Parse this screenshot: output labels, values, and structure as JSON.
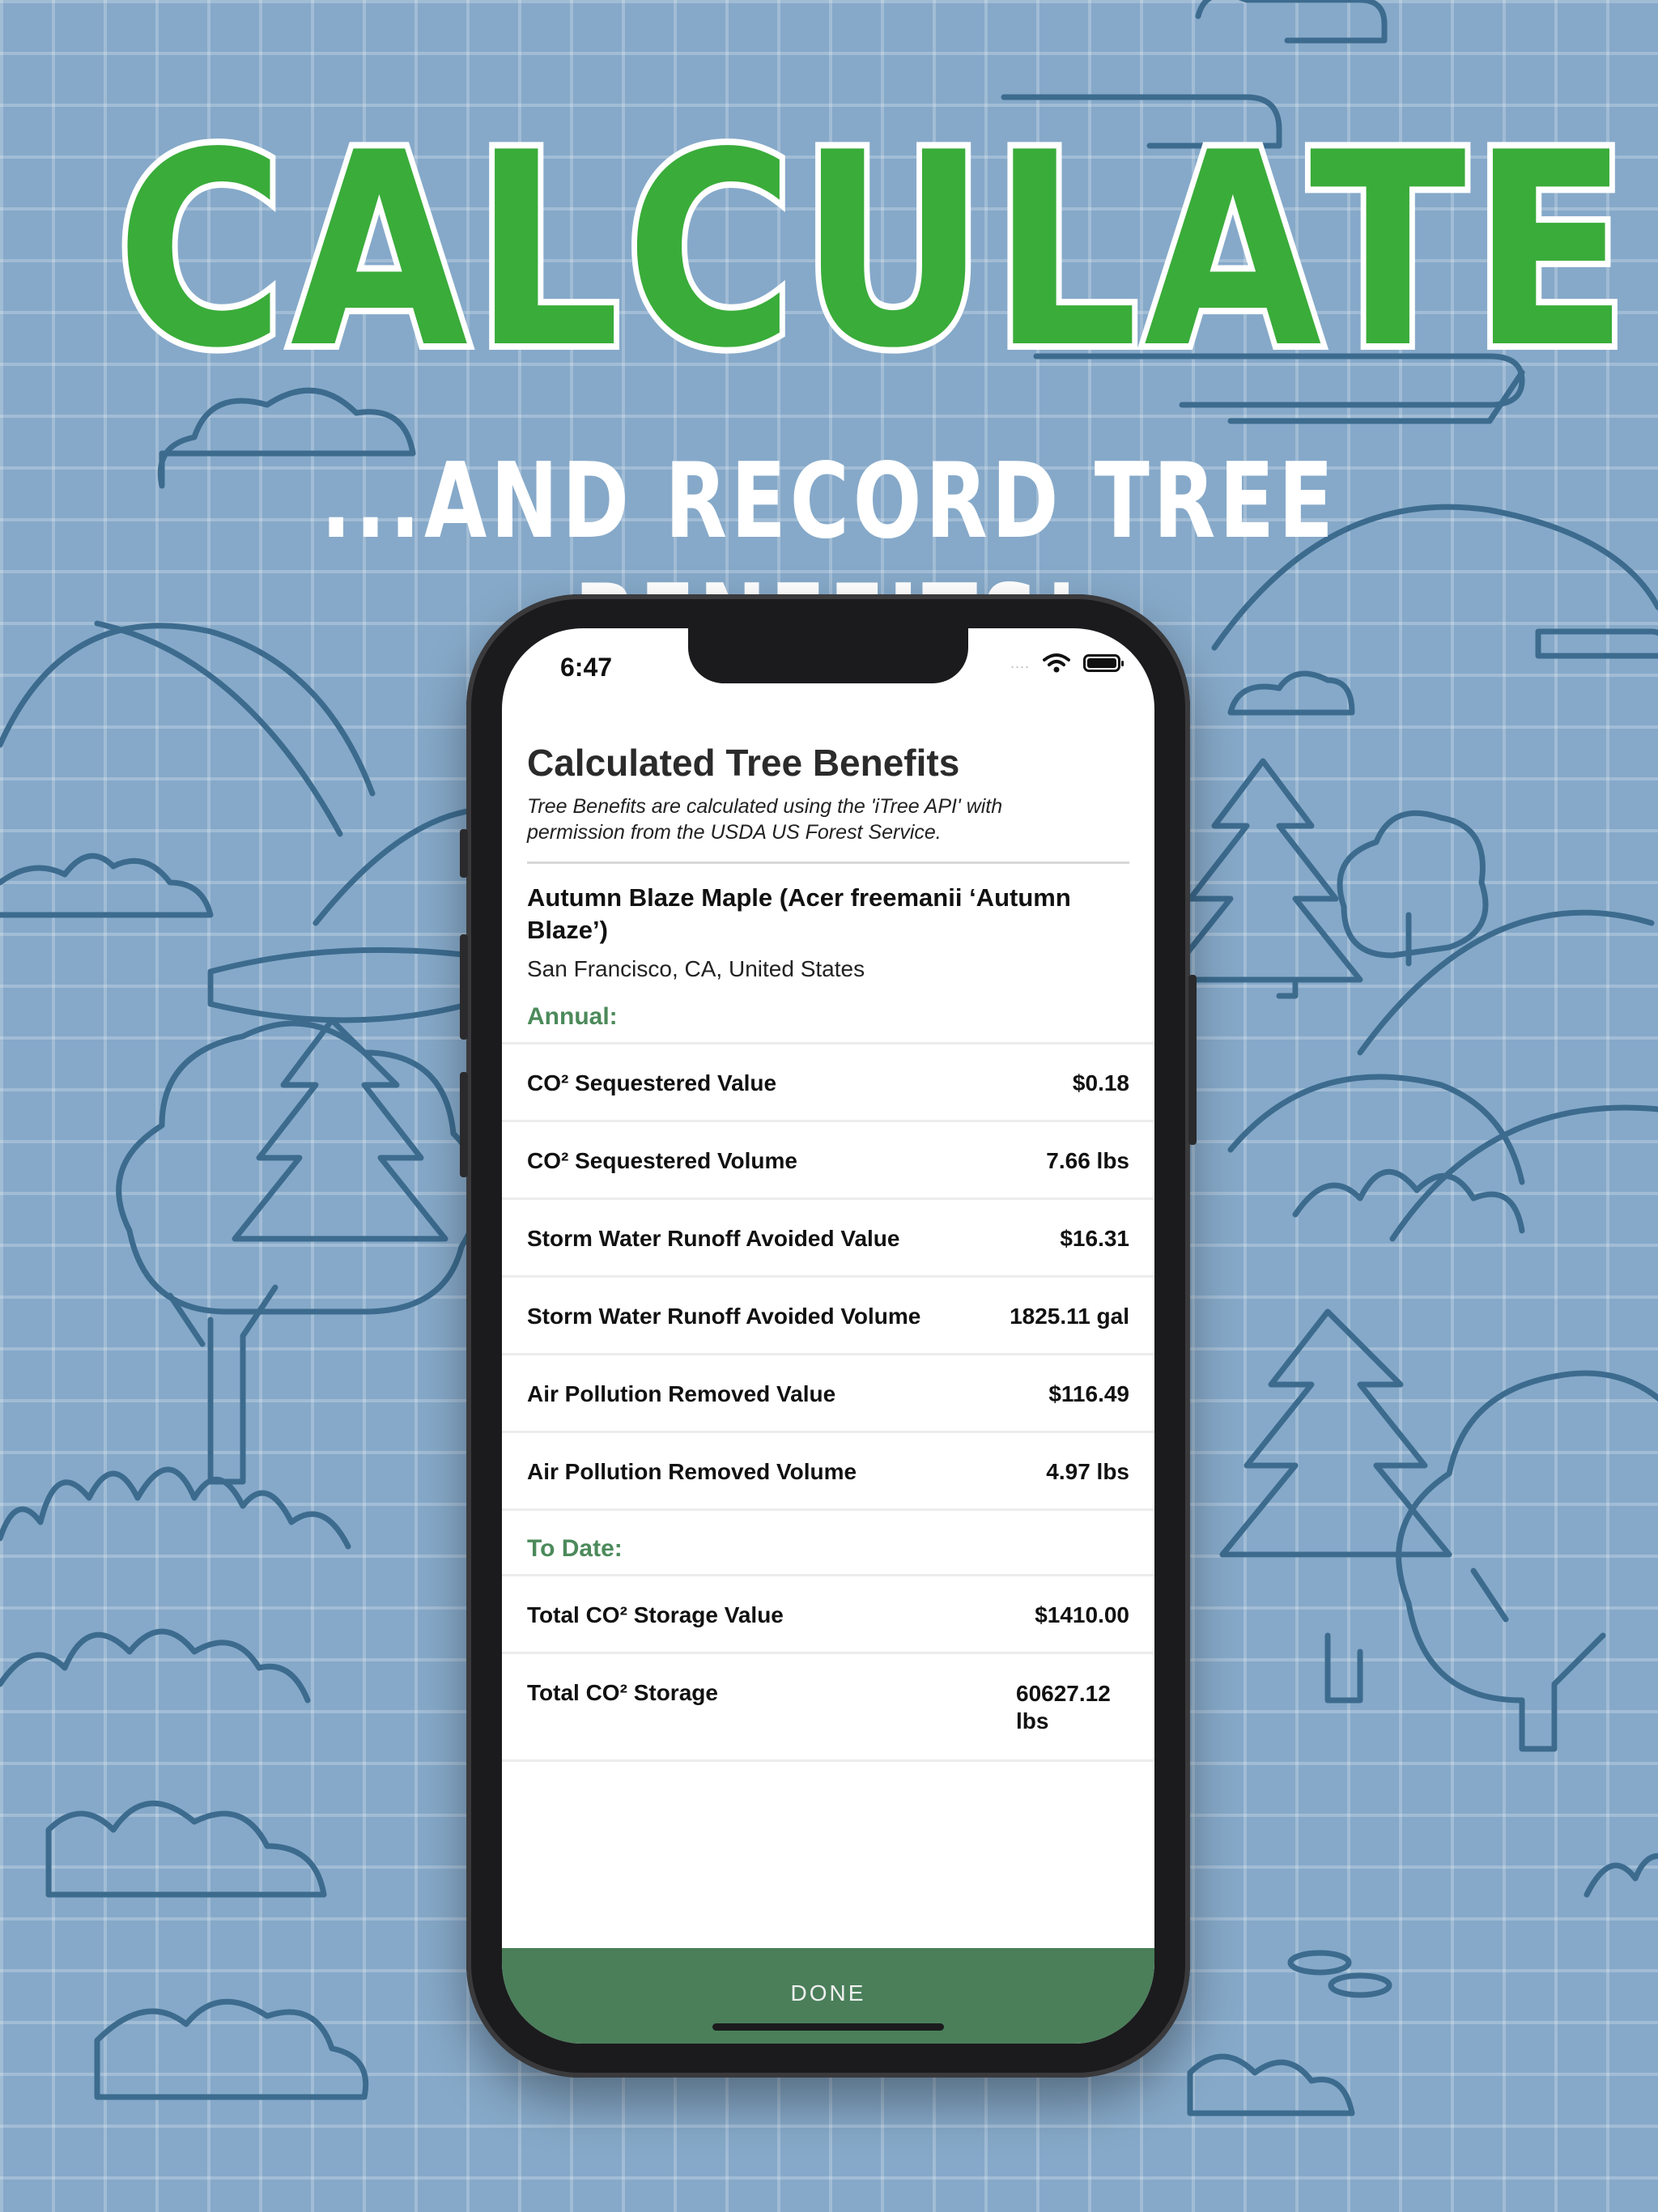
{
  "headline": {
    "main": "CALCULATE",
    "sub": "...AND RECORD TREE BENEFITS!"
  },
  "status_bar": {
    "time": "6:47",
    "signal_dots": "....",
    "wifi_icon": "wifi-icon",
    "battery_icon": "battery-icon"
  },
  "screen": {
    "title": "Calculated Tree Benefits",
    "note": "Tree Benefits are calculated using the 'iTree API' with permission from the USDA US Forest Service.",
    "tree_name": "Autumn Blaze Maple (Acer freemanii ‘Autumn Blaze’)",
    "location": "San Francisco, CA, United States",
    "annual_heading": "Annual:",
    "annual_rows": [
      {
        "label": "CO² Sequestered Value",
        "value": "$0.18"
      },
      {
        "label": "CO² Sequestered Volume",
        "value": "7.66 lbs"
      },
      {
        "label": "Storm Water Runoff Avoided Value",
        "value": "$16.31"
      },
      {
        "label": "Storm Water Runoff Avoided Volume",
        "value": "1825.11 gal"
      },
      {
        "label": "Air Pollution Removed Value",
        "value": "$116.49"
      },
      {
        "label": "Air Pollution Removed Volume",
        "value": "4.97 lbs"
      }
    ],
    "to_date_heading": "To Date:",
    "to_date_rows": [
      {
        "label": "Total CO² Storage Value",
        "value": "$1410.00"
      },
      {
        "label": "Total CO² Storage",
        "value": "60627.12 lbs"
      }
    ],
    "done_label": "DONE"
  },
  "colors": {
    "background": "#86a9c9",
    "headline_green": "#3aac3a",
    "section_green": "#4c8a5b",
    "done_bar": "#4a7f5a"
  }
}
